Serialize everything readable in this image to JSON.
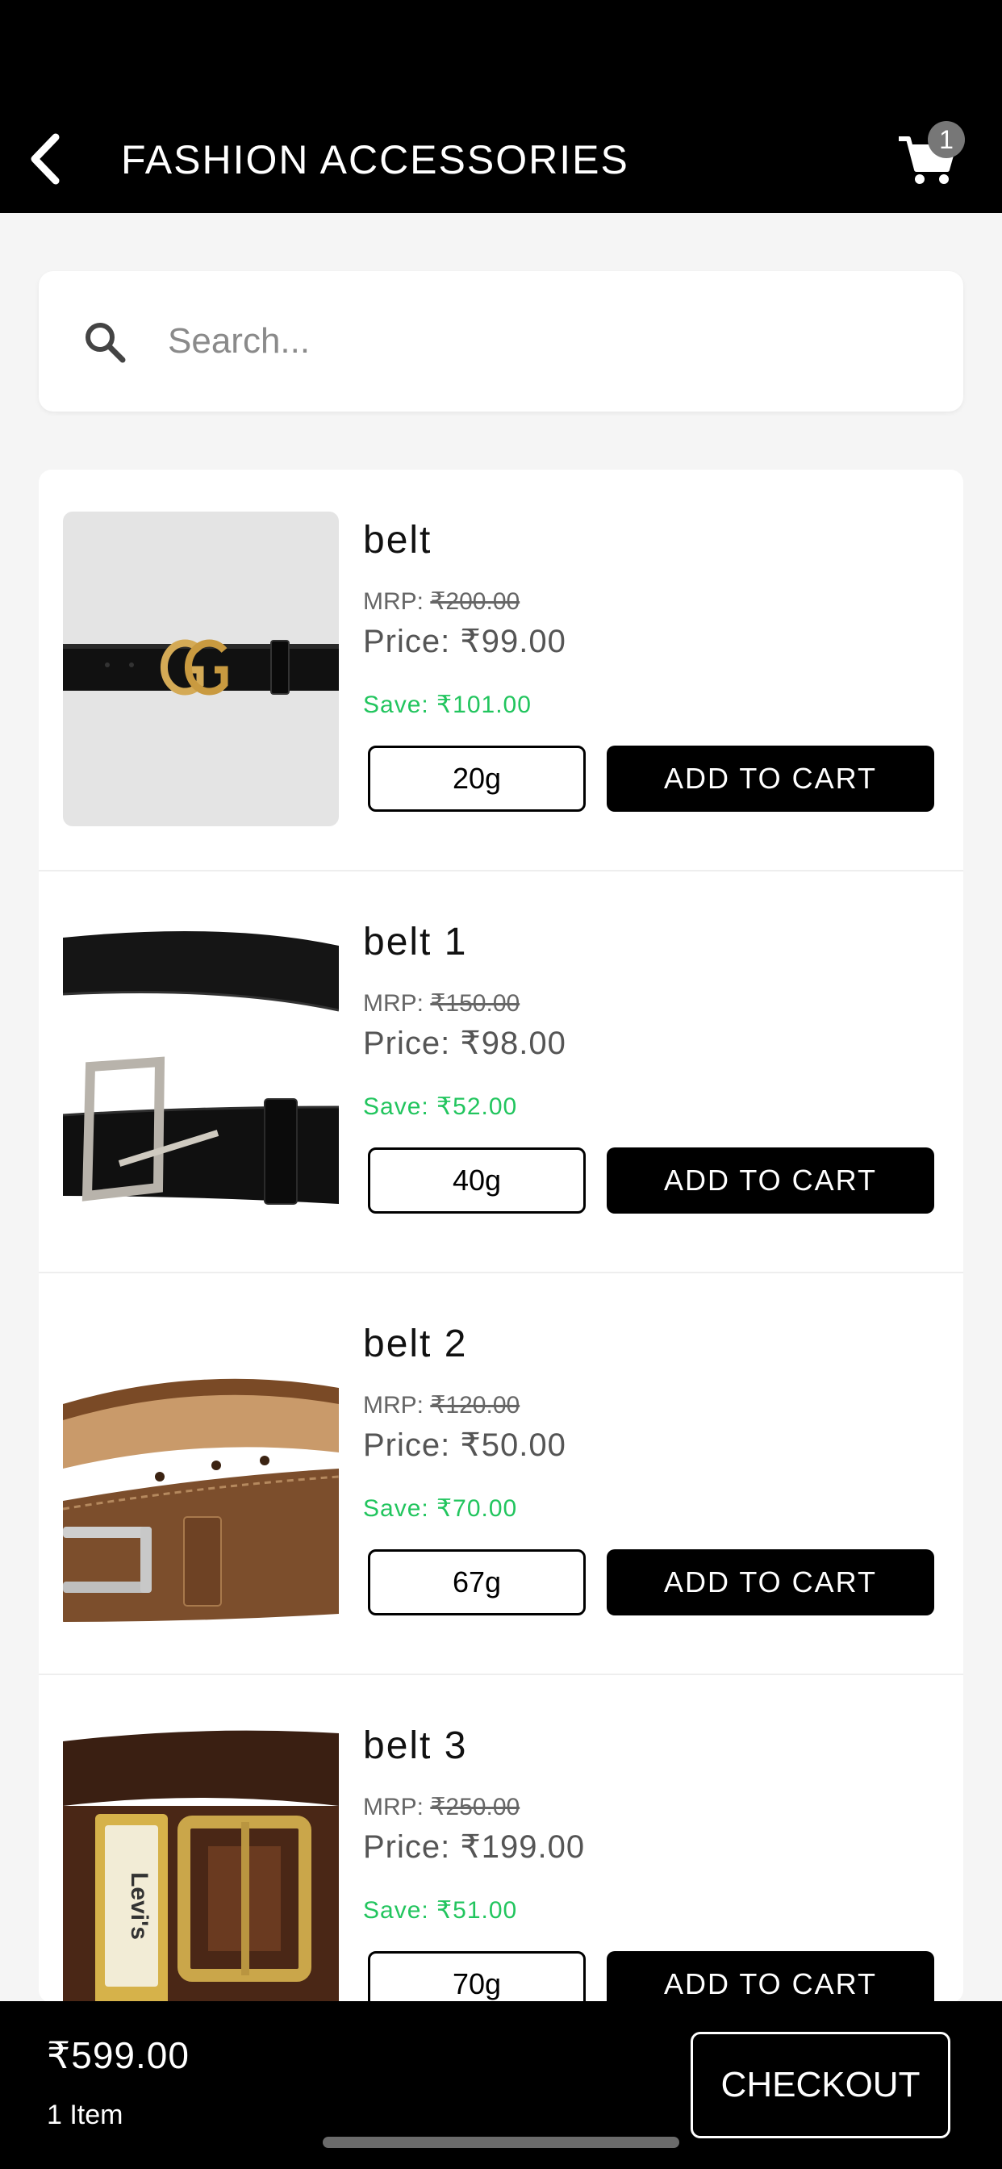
{
  "header": {
    "title": "FASHION ACCESSORIES",
    "cart_count": "1"
  },
  "search": {
    "placeholder": "Search..."
  },
  "products": [
    {
      "name": "belt",
      "mrp_label": "MRP: ",
      "mrp": "₹200.00",
      "price": "Price: ₹99.00",
      "save": "Save: ₹101.00",
      "weight": "20g",
      "add_label": "ADD TO CART"
    },
    {
      "name": "belt 1",
      "mrp_label": "MRP: ",
      "mrp": "₹150.00",
      "price": "Price: ₹98.00",
      "save": "Save: ₹52.00",
      "weight": "40g",
      "add_label": "ADD TO CART"
    },
    {
      "name": "belt 2",
      "mrp_label": "MRP: ",
      "mrp": "₹120.00",
      "price": "Price: ₹50.00",
      "save": "Save: ₹70.00",
      "weight": "67g",
      "add_label": "ADD TO CART"
    },
    {
      "name": "belt 3",
      "mrp_label": "MRP: ",
      "mrp": "₹250.00",
      "price": "Price: ₹199.00",
      "save": "Save: ₹51.00",
      "weight": "70g",
      "add_label": "ADD TO CART"
    }
  ],
  "footer": {
    "total": "₹599.00",
    "item_count": "1 Item",
    "checkout_label": "CHECKOUT"
  },
  "colors": {
    "save_green": "#22c55e",
    "header_bg": "#000000",
    "page_bg": "#f5f5f5"
  }
}
